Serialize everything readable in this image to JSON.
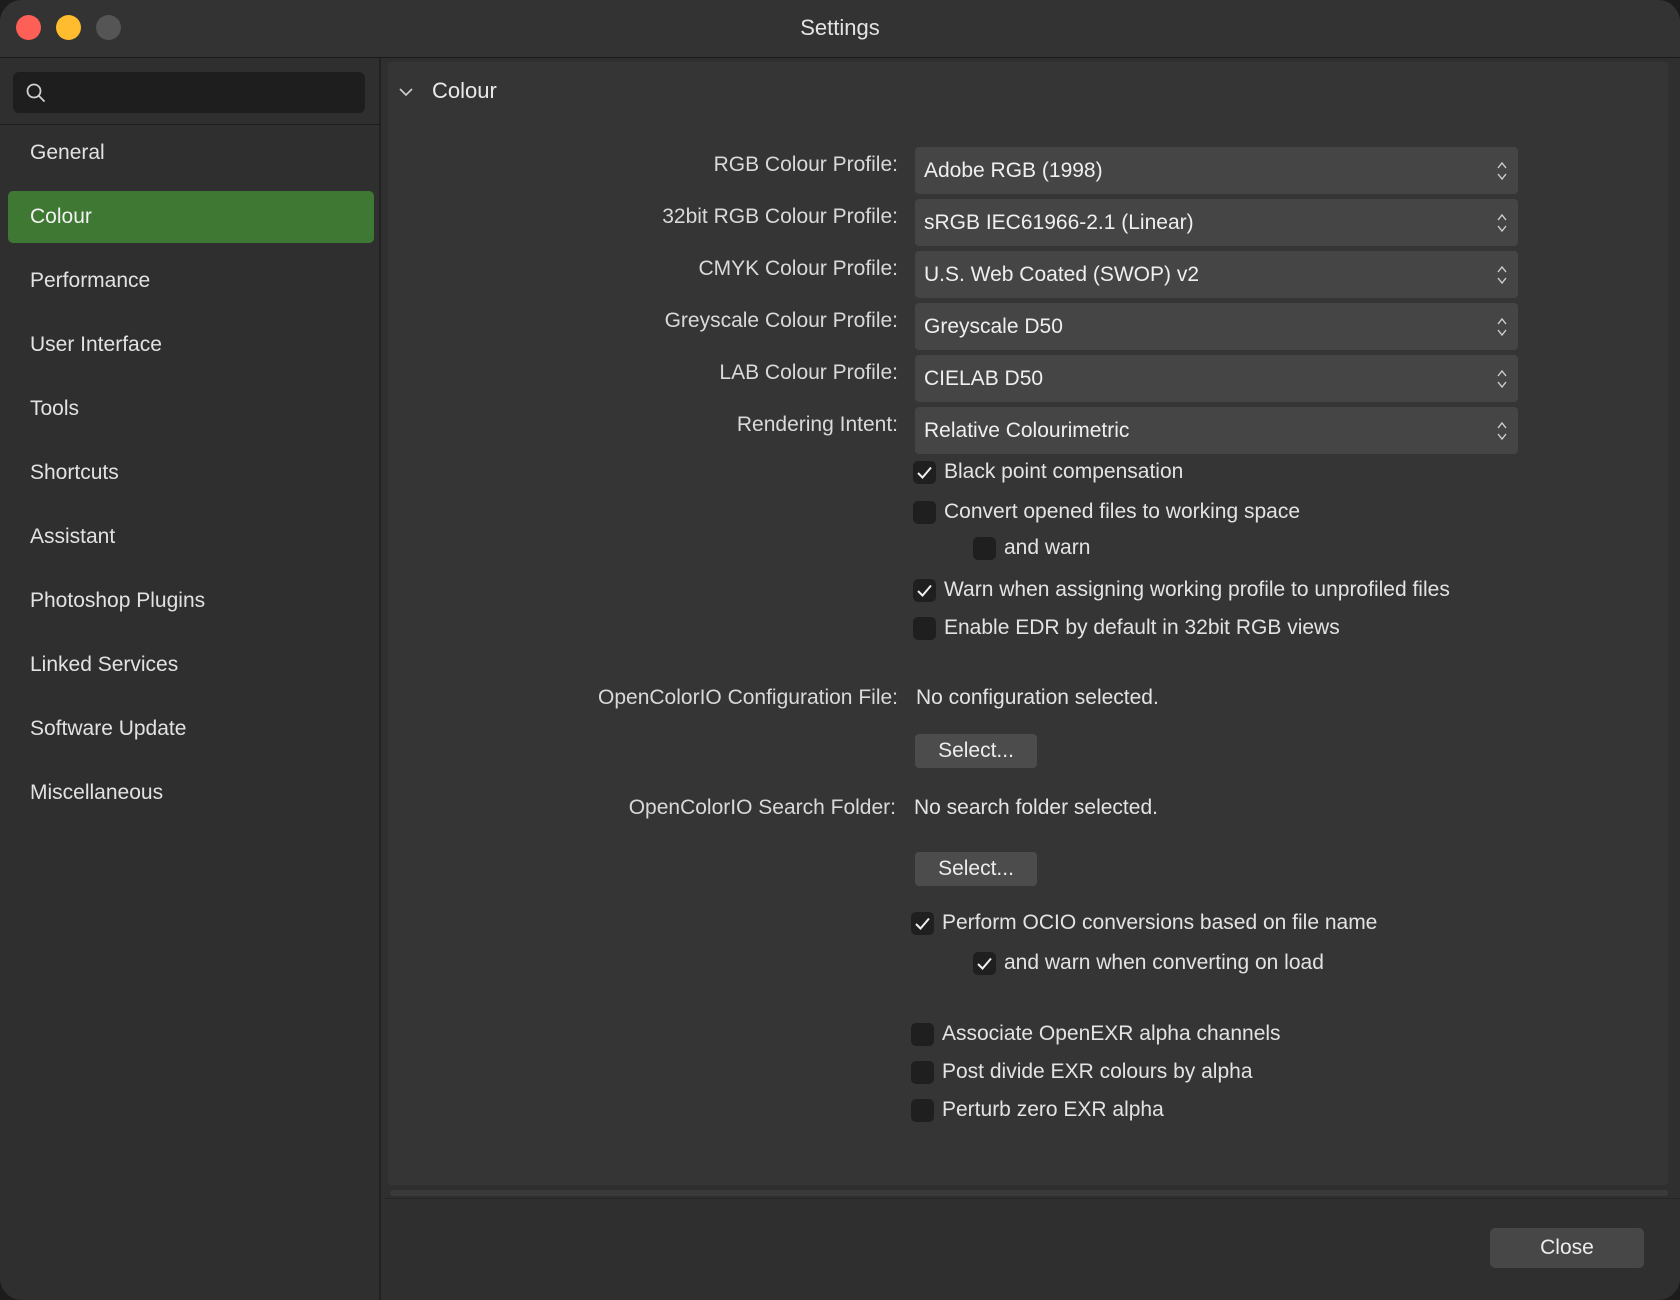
{
  "window": {
    "title": "Settings"
  },
  "search": {
    "placeholder": "",
    "icon": "search-icon"
  },
  "sidebar": {
    "items": [
      {
        "label": "General",
        "active": false
      },
      {
        "label": "Colour",
        "active": true
      },
      {
        "label": "Performance",
        "active": false
      },
      {
        "label": "User Interface",
        "active": false
      },
      {
        "label": "Tools",
        "active": false
      },
      {
        "label": "Shortcuts",
        "active": false
      },
      {
        "label": "Assistant",
        "active": false
      },
      {
        "label": "Photoshop Plugins",
        "active": false
      },
      {
        "label": "Linked Services",
        "active": false
      },
      {
        "label": "Software Update",
        "active": false
      },
      {
        "label": "Miscellaneous",
        "active": false
      }
    ],
    "active_color": "#3e7833"
  },
  "section": {
    "title": "Colour",
    "expanded": true
  },
  "profiles": [
    {
      "label": "RGB Colour Profile:",
      "value": "Adobe RGB (1998)"
    },
    {
      "label": "32bit RGB Colour Profile:",
      "value": "sRGB IEC61966-2.1 (Linear)"
    },
    {
      "label": "CMYK Colour Profile:",
      "value": "U.S. Web Coated (SWOP) v2"
    },
    {
      "label": "Greyscale Colour Profile:",
      "value": "Greyscale D50"
    },
    {
      "label": "LAB Colour Profile:",
      "value": "CIELAB D50"
    },
    {
      "label": "Rendering Intent:",
      "value": "Relative Colourimetric"
    }
  ],
  "options": [
    {
      "label": "Black point compensation",
      "checked": true
    },
    {
      "label": "Convert opened files to working space",
      "checked": false
    },
    {
      "label": "and warn",
      "checked": false
    },
    {
      "label": "Warn when assigning working profile to unprofiled files",
      "checked": true
    },
    {
      "label": "Enable EDR by default in 32bit RGB views",
      "checked": false
    }
  ],
  "ocio": {
    "config_label": "OpenColorIO Configuration File:",
    "config_value": "No configuration selected.",
    "config_button": "Select...",
    "folder_label": "OpenColorIO Search Folder:",
    "folder_value": "No search folder selected.",
    "folder_button": "Select..."
  },
  "ocio_options": [
    {
      "label": "Perform OCIO conversions based on file name",
      "checked": true
    },
    {
      "label": "and warn when converting on load",
      "checked": true
    }
  ],
  "exr_options": [
    {
      "label": "Associate OpenEXR alpha channels",
      "checked": false
    },
    {
      "label": "Post divide EXR colours by alpha",
      "checked": false
    },
    {
      "label": "Perturb zero EXR alpha",
      "checked": false
    }
  ],
  "footer": {
    "close_label": "Close"
  }
}
